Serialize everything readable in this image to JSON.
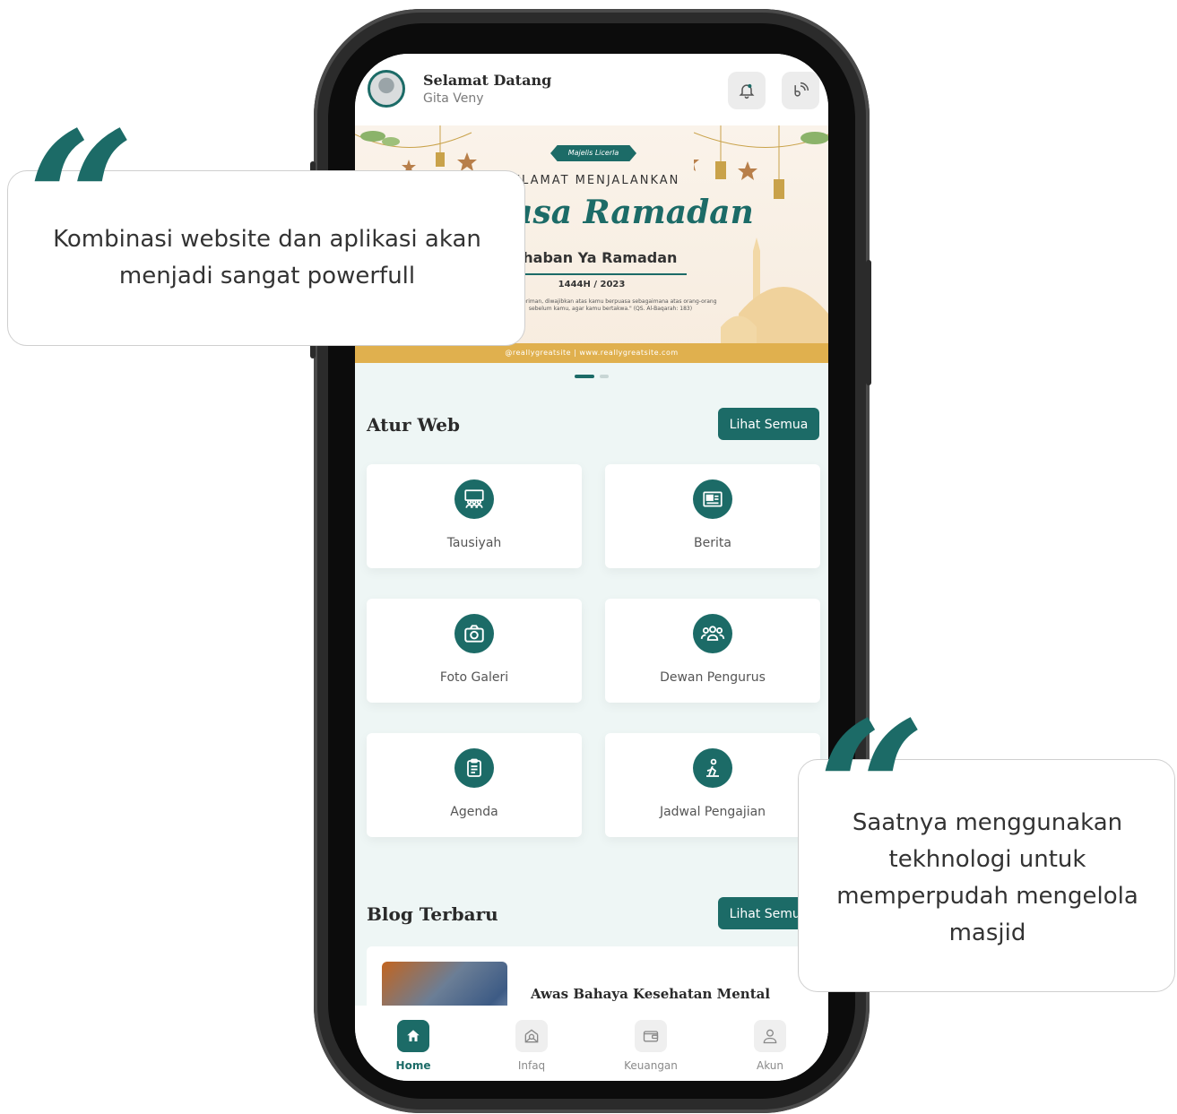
{
  "header": {
    "greeting": "Selamat Datang",
    "user_name": "Gita Veny",
    "buttons": [
      {
        "icon": "bell-icon"
      },
      {
        "icon": "broadcast-icon"
      }
    ]
  },
  "banner": {
    "badge": "Majelis Licerla",
    "line1": "SELAMAT MENJALANKAN",
    "title": "h Puasa Ramadan",
    "subtitle": "arhaban Ya Ramadan",
    "year": "1444H / 2023",
    "verse": "yang beriman, diwajibkan atas kamu berpuasa sebagaimana atas orang-orang sebelum kamu, agar kamu bertakwa.\" (QS. Al-Baqarah: 183)",
    "footer": "@reallygreatsite | www.reallygreatsite.com",
    "slides": 2,
    "active_slide": 1
  },
  "atur_web": {
    "title": "Atur Web",
    "see_all": "Lihat Semua",
    "items": [
      {
        "label": "Tausiyah",
        "icon": "audience-icon"
      },
      {
        "label": "Berita",
        "icon": "newspaper-icon"
      },
      {
        "label": "Foto Galeri",
        "icon": "camera-icon"
      },
      {
        "label": "Dewan Pengurus",
        "icon": "group-icon"
      },
      {
        "label": "Agenda",
        "icon": "clipboard-icon"
      },
      {
        "label": "Jadwal Pengajian",
        "icon": "reading-person-icon"
      }
    ]
  },
  "blog": {
    "title": "Blog Terbaru",
    "see_all": "Lihat Semua",
    "posts": [
      {
        "title": "Awas Bahaya Kesehatan Mental"
      }
    ]
  },
  "tabbar": {
    "items": [
      {
        "label": "Home",
        "icon": "home-icon",
        "active": true
      },
      {
        "label": "Infaq",
        "icon": "donation-icon",
        "active": false
      },
      {
        "label": "Keuangan",
        "icon": "wallet-icon",
        "active": false
      },
      {
        "label": "Akun",
        "icon": "user-icon",
        "active": false
      }
    ]
  },
  "quotes": [
    {
      "text": "Kombinasi website dan aplikasi akan menjadi sangat powerfull"
    },
    {
      "text": "Saatnya menggunakan tekhnologi untuk memperpudah mengelola masjid"
    }
  ],
  "colors": {
    "accent": "#1c6b67",
    "banner_gold": "#e0b04e"
  }
}
